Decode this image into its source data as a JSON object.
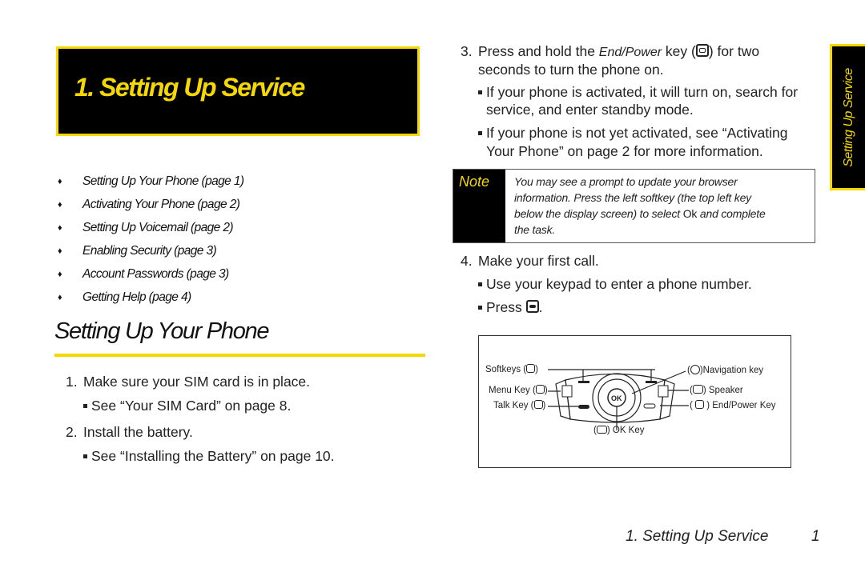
{
  "chapter": {
    "title": "1. Setting Up Service"
  },
  "toc": [
    {
      "label": "Setting Up Your Phone (page 1)"
    },
    {
      "label": "Activating Your Phone (page 2)"
    },
    {
      "label": "Setting Up Voicemail (page 2)"
    },
    {
      "label": "Enabling Security (page 3)"
    },
    {
      "label": "Account Passwords (page 3)"
    },
    {
      "label": "Getting Help (page 4)"
    }
  ],
  "toc_bullet": "♦",
  "section": {
    "title": "Setting Up Your Phone"
  },
  "steps": [
    {
      "num": "1.",
      "text": "Make sure your SIM card is in place.",
      "subs": [
        "See “Your SIM Card” on page 8."
      ]
    },
    {
      "num": "2.",
      "text": "Install the battery.",
      "subs": [
        "See “Installing the Battery” on page 10."
      ]
    },
    {
      "num": "3.",
      "text_before": "Press and hold the ",
      "text_em": "End/Power",
      "text_mid": " key (",
      "text_after": ") for two",
      "text_line2": "seconds to turn the phone on.",
      "subs": [
        {
          "line1": "If your phone is activated, it will turn on, search for",
          "line2": "service, and enter standby mode."
        },
        {
          "line1": "If your phone is not yet activated, see “Activating",
          "line2": "Your Phone” on page 2 for more information."
        }
      ]
    },
    {
      "num": "4.",
      "text": "Make your first call.",
      "subs": [
        "Use your keypad to enter a phone number.",
        "Press"
      ]
    }
  ],
  "note": {
    "label": "Note",
    "line1": "You may see a prompt to update your browser",
    "line2": "information. Press the left softkey (the top left key",
    "line3_before": "below the display screen) to select ",
    "line3_ok": "Ok",
    "line3_after": " and complete",
    "line4": "the task."
  },
  "diagram": {
    "labels": {
      "softkeys": "Softkeys (",
      "menu_key": "Menu Key (",
      "talk_key": "Talk Key (",
      "ok_key": "OK Key",
      "navigation_key": ")Navigation key",
      "speaker": ") Speaker",
      "end_power_key": ") End/Power Key"
    },
    "ok_text": "OK"
  },
  "side_tab": {
    "label": "Setting Up Service"
  },
  "footer": {
    "title": "1. Setting Up Service",
    "page": "1"
  },
  "colors": {
    "accent_yellow": "#f5d800",
    "black": "#000000"
  }
}
